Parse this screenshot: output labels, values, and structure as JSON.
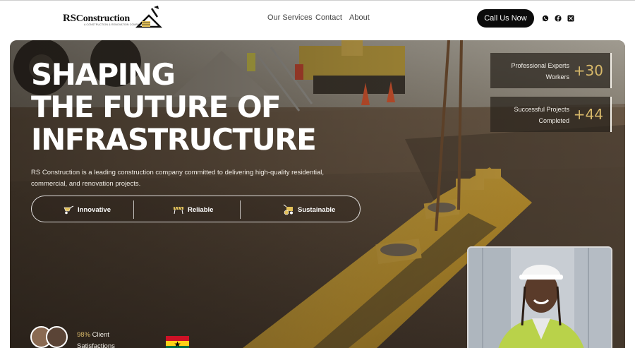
{
  "brand": {
    "name_rs": "RS",
    "name_rest": "Construction",
    "tagline": "A CONSTRUCTION & RENOVATION COMPANY"
  },
  "nav": {
    "links": [
      "Our Services",
      "Contact",
      "About"
    ],
    "cta_label": "Call Us Now",
    "social_icons": [
      "whatsapp-icon",
      "facebook-icon",
      "x-twitter-icon"
    ]
  },
  "hero": {
    "headline_lines": [
      "SHAPING",
      "THE FUTURE OF",
      "INFRASTRUCTURE"
    ],
    "description": "RS Construction is a leading construction company committed to delivering high-quality residential, commercial, and renovation projects.",
    "features": [
      {
        "label": "Innovative",
        "icon": "wheelbarrow-icon"
      },
      {
        "label": "Reliable",
        "icon": "barrier-icon"
      },
      {
        "label": "Sustainable",
        "icon": "roller-icon"
      }
    ],
    "stats": [
      {
        "label_line1": "Professional Experts",
        "label_line2": "Workers",
        "value": "+30"
      },
      {
        "label_line1": "Successful Projects",
        "label_line2": "Completed",
        "value": "+44"
      }
    ],
    "client_stat": {
      "percent": "98%",
      "text_line1": "Client",
      "text_line2": "Satisfactions"
    }
  },
  "colors": {
    "accent_gold": "#d8b96a",
    "cta_bg": "#0b0b0b",
    "pipe_yellow": "#c9a13a"
  }
}
